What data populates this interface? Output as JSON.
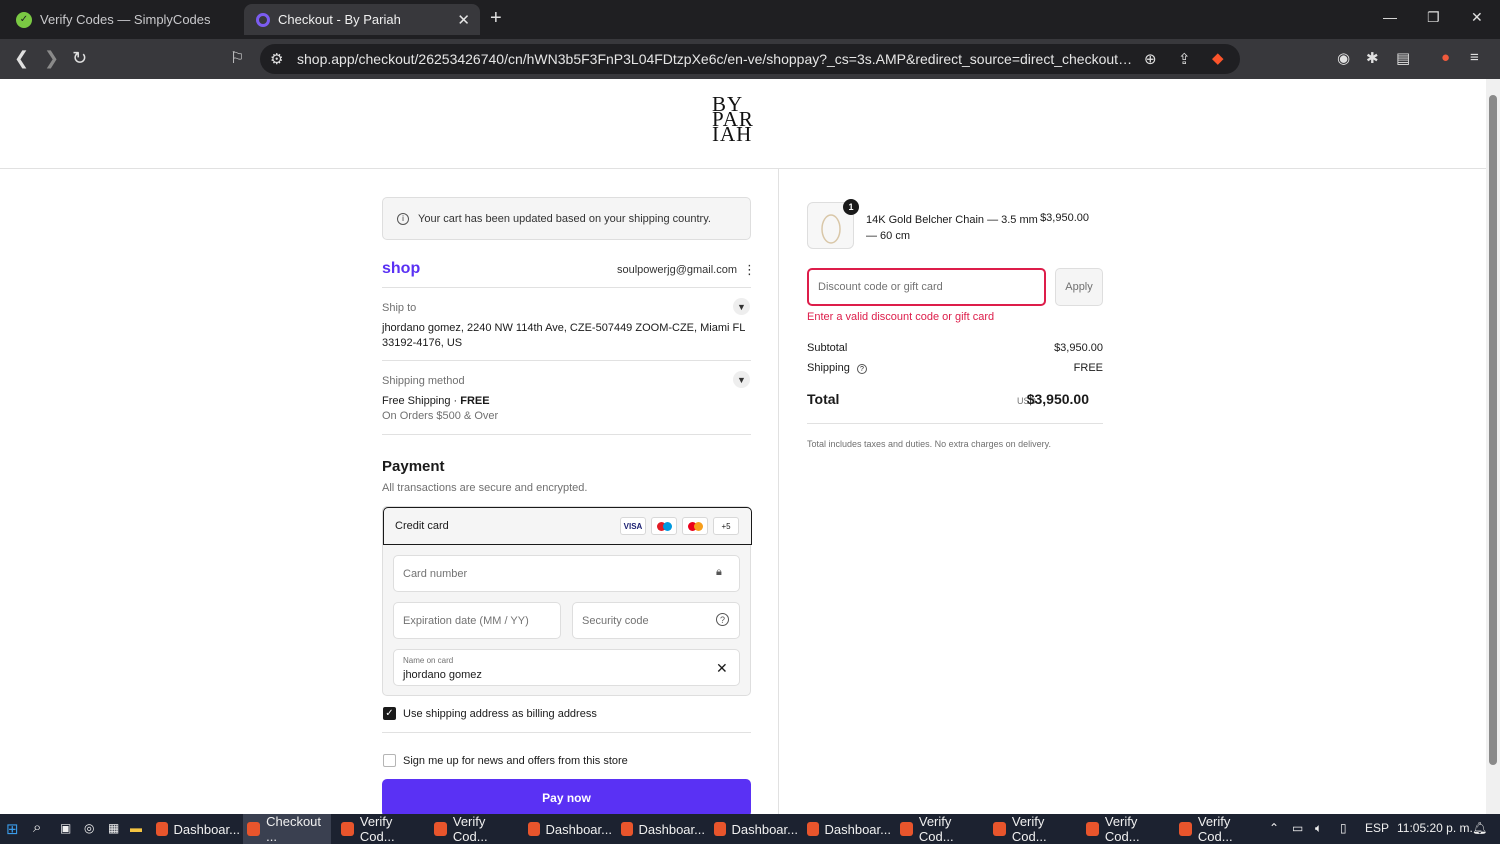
{
  "browser": {
    "tabs": [
      {
        "title": "Verify Codes — SimplyCodes",
        "active": false
      },
      {
        "title": "Checkout - By Pariah",
        "active": true
      }
    ],
    "url": "shop.app/checkout/26253426740/cn/hWN3b5F3FnP3L04FDtzpXe6c/en-ve/shoppay?_cs=3s.AMP&redirect_source=direct_checkout_prod...",
    "new_tab": "+",
    "close": "✕"
  },
  "store": {
    "logo_lines": [
      "BY",
      "PAR",
      "IAH"
    ]
  },
  "notice": {
    "text": "Your cart has been updated based on your shipping country."
  },
  "account": {
    "brand": "shop",
    "email": "soulpowerjg@gmail.com"
  },
  "ship_to": {
    "label": "Ship to",
    "address": "jhordano gomez, 2240 NW 114th Ave, CZE-507449 ZOOM-CZE, Miami FL 33192-4176, US"
  },
  "shipping_method": {
    "label": "Shipping method",
    "name": "Free Shipping · ",
    "price": "FREE",
    "note": "On Orders $500 & Over"
  },
  "payment": {
    "heading": "Payment",
    "subheading": "All transactions are secure and encrypted.",
    "method_label": "Credit card",
    "card_brands": [
      "VISA",
      "maestro",
      "mastercard",
      "+5"
    ],
    "card_number_placeholder": "Card number",
    "expiry_placeholder": "Expiration date (MM / YY)",
    "security_placeholder": "Security code",
    "name_label": "Name on card",
    "name_value": "jhordano gomez"
  },
  "billing_checkbox": {
    "label": "Use shipping address as billing address",
    "checked": true
  },
  "newsletter_checkbox": {
    "label": "Sign me up for news and offers from this store",
    "checked": false
  },
  "pay_button": "Pay now",
  "summary": {
    "item": {
      "name": "14K Gold Belcher Chain — 3.5 mm — 60 cm",
      "price": "$3,950.00",
      "quantity": "1"
    },
    "discount_placeholder": "Discount code or gift card",
    "apply_label": "Apply",
    "error": "Enter a valid discount code or gift card",
    "subtotal_label": "Subtotal",
    "subtotal_value": "$3,950.00",
    "shipping_label": "Shipping",
    "shipping_value": "FREE",
    "total_label": "Total",
    "total_currency": "USD",
    "total_value": "$3,950.00",
    "tax_note": "Total includes taxes and duties. No extra charges on delivery."
  },
  "taskbar": {
    "items": [
      "Dashboar...",
      "Checkout ...",
      "Verify Cod...",
      "Verify Cod...",
      "Dashboar...",
      "Dashboar...",
      "Dashboar...",
      "Dashboar...",
      "Verify Cod...",
      "Verify Cod...",
      "Verify Cod...",
      "Verify Cod..."
    ],
    "language": "ESP",
    "clock": "11:05:20 p. m."
  },
  "colors": {
    "accent": "#5a31f4",
    "error": "#dd1d4a"
  }
}
